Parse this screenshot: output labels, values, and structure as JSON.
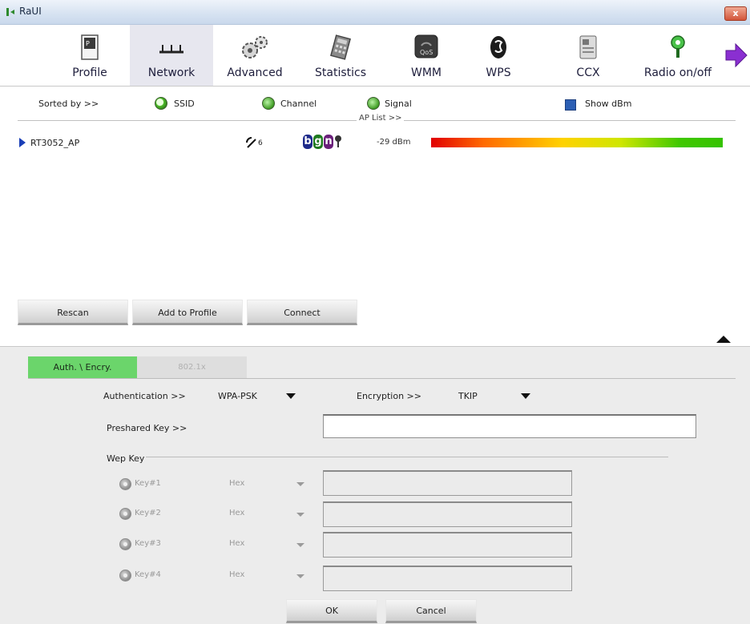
{
  "window": {
    "title": "RaUI",
    "close_label": "x"
  },
  "toolbar": {
    "items": [
      {
        "label": "Profile",
        "icon": "profile-icon"
      },
      {
        "label": "Network",
        "icon": "network-icon",
        "active": true
      },
      {
        "label": "Advanced",
        "icon": "gears-icon"
      },
      {
        "label": "Statistics",
        "icon": "calculator-icon"
      },
      {
        "label": "WMM",
        "icon": "qos-icon"
      },
      {
        "label": "WPS",
        "icon": "wps-icon"
      },
      {
        "label": "CCX",
        "icon": "ccx-icon"
      },
      {
        "label": "Radio on/off",
        "icon": "radio-icon"
      }
    ],
    "next_icon": "next-arrow-icon"
  },
  "sort": {
    "label": "Sorted by >>",
    "ssid": "SSID",
    "channel": "Channel",
    "signal": "Signal",
    "selected": "SSID",
    "show_dbm": "Show dBm",
    "show_dbm_checked": true
  },
  "aplist": {
    "header": "AP List >>",
    "rows": [
      {
        "ssid": "RT3052_AP",
        "channel": "6",
        "modes": [
          "b",
          "g",
          "n"
        ],
        "signal": "-29 dBm",
        "signal_fraction": 1.0
      }
    ]
  },
  "buttons": {
    "rescan": "Rescan",
    "add_to_profile": "Add to Profile",
    "connect": "Connect"
  },
  "tabs": {
    "auth": "Auth. \\ Encry.",
    "dot1x": "802.1x"
  },
  "auth": {
    "authentication_label": "Authentication >>",
    "authentication_value": "WPA-PSK",
    "encryption_label": "Encryption >>",
    "encryption_value": "TKIP",
    "preshared_label": "Preshared Key >>",
    "preshared_value": ""
  },
  "wep": {
    "label": "Wep Key",
    "keys": [
      {
        "label": "Key#1",
        "format": "Hex"
      },
      {
        "label": "Key#2",
        "format": "Hex"
      },
      {
        "label": "Key#3",
        "format": "Hex"
      },
      {
        "label": "Key#4",
        "format": "Hex"
      }
    ]
  },
  "footer": {
    "ok": "OK",
    "cancel": "Cancel"
  },
  "colors": {
    "active_tab": "#6bd56b",
    "ap_arrow": "#1a3fb7",
    "radio_green": "#3e9b22"
  }
}
